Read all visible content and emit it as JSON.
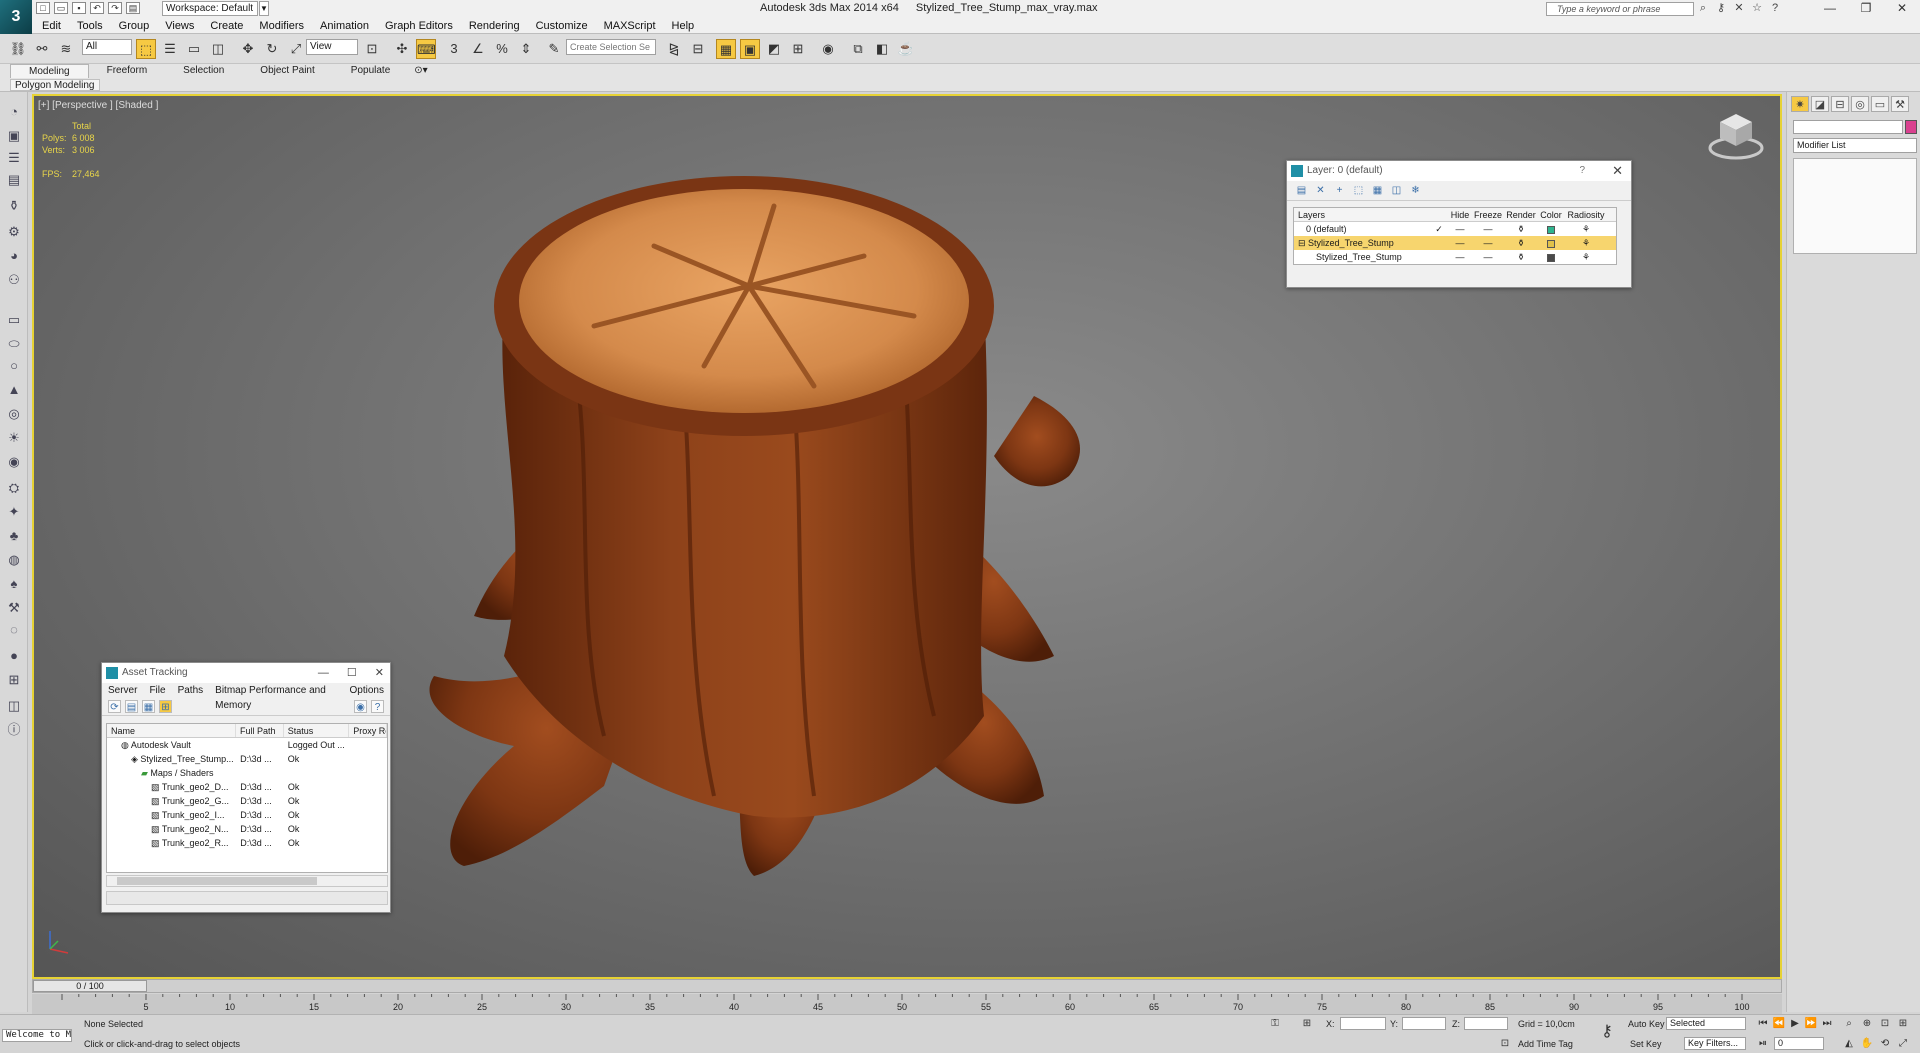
{
  "app": {
    "logo": "3",
    "title_app": "Autodesk 3ds Max  2014 x64",
    "title_file": "Stylized_Tree_Stump_max_vray.max",
    "workspace": "Workspace: Default",
    "search_placeholder": "Type a keyword or phrase"
  },
  "menu": [
    "Edit",
    "Tools",
    "Group",
    "Views",
    "Create",
    "Modifiers",
    "Animation",
    "Graph Editors",
    "Rendering",
    "Customize",
    "MAXScript",
    "Help"
  ],
  "toolbar": {
    "filter": "All",
    "coord_system": "View",
    "selection_set_placeholder": "Create Selection Se"
  },
  "ribbon": {
    "tabs": [
      "Modeling",
      "Freeform",
      "Selection",
      "Object Paint",
      "Populate"
    ],
    "panel": "Polygon Modeling"
  },
  "viewport": {
    "label": "[+] [Perspective ] [Shaded ]",
    "stats": {
      "total": "Total",
      "polys_label": "Polys:",
      "polys": "6 008",
      "verts_label": "Verts:",
      "verts": "3 006",
      "fps_label": "FPS:",
      "fps": "27,464"
    }
  },
  "layer_dialog": {
    "title": "Layer: 0 (default)",
    "help": "?",
    "headers": [
      "Layers",
      "Hide",
      "Freeze",
      "Render",
      "Color",
      "Radiosity"
    ],
    "rows": [
      {
        "name": "0 (default)",
        "active": "✓",
        "color": "#2fb58f"
      },
      {
        "name": "Stylized_Tree_Stump",
        "active": "",
        "color": "#e0c14a"
      },
      {
        "name": "Stylized_Tree_Stump",
        "active": "",
        "color": "#4a4a4a"
      }
    ]
  },
  "asset_dialog": {
    "title": "Asset Tracking",
    "menu": [
      "Server",
      "File",
      "Paths",
      "Bitmap Performance and Memory",
      "Options"
    ],
    "headers": [
      "Name",
      "Full Path",
      "Status",
      "Proxy Re"
    ],
    "rows": [
      {
        "name": "Autodesk Vault",
        "path": "",
        "status": "Logged Out ..."
      },
      {
        "name": "Stylized_Tree_Stump...",
        "path": "D:\\3d ...",
        "status": "Ok"
      },
      {
        "name": "Maps / Shaders",
        "path": "",
        "status": ""
      },
      {
        "name": "Trunk_geo2_D...",
        "path": "D:\\3d ...",
        "status": "Ok"
      },
      {
        "name": "Trunk_geo2_G...",
        "path": "D:\\3d ...",
        "status": "Ok"
      },
      {
        "name": "Trunk_geo2_I...",
        "path": "D:\\3d ...",
        "status": "Ok"
      },
      {
        "name": "Trunk_geo2_N...",
        "path": "D:\\3d ...",
        "status": "Ok"
      },
      {
        "name": "Trunk_geo2_R...",
        "path": "D:\\3d ...",
        "status": "Ok"
      }
    ]
  },
  "command_panel": {
    "modifier_list": "Modifier List"
  },
  "timeline": {
    "frame": "0 / 100",
    "ticks": [
      "5",
      "10",
      "15",
      "20",
      "25",
      "30",
      "35",
      "40",
      "45",
      "50",
      "55",
      "60",
      "65",
      "70",
      "75",
      "80",
      "85",
      "90",
      "95",
      "100"
    ]
  },
  "status": {
    "maxscript": "Welcome to M",
    "selection": "None Selected",
    "prompt": "Click or click-and-drag to select objects",
    "x_label": "X:",
    "y_label": "Y:",
    "z_label": "Z:",
    "grid": "Grid = 10,0cm",
    "add_time_tag": "Add Time Tag",
    "auto_key": "Auto Key",
    "set_key": "Set Key",
    "key_mode": "Selected",
    "key_filters": "Key Filters...",
    "current_frame": "0"
  }
}
